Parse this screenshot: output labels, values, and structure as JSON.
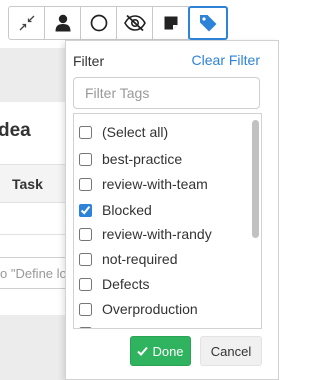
{
  "background": {
    "heading_fragment": "dea",
    "column_header": "Task",
    "input_placeholder_fragment": "o \"Define lo"
  },
  "toolbar": {
    "buttons": [
      {
        "icon": "collapse-arrows-icon",
        "active": false
      },
      {
        "icon": "user-icon",
        "active": false
      },
      {
        "icon": "circle-icon",
        "active": false
      },
      {
        "icon": "eye-slash-icon",
        "active": false
      },
      {
        "icon": "sticky-note-icon",
        "active": false
      },
      {
        "icon": "tag-icon",
        "active": true
      }
    ],
    "accent_color": "#2d83d8"
  },
  "filter_popup": {
    "title": "Filter",
    "clear_label": "Clear Filter",
    "search_placeholder": "Filter Tags",
    "search_value": "",
    "tags": [
      {
        "label": "(Select all)",
        "checked": false
      },
      {
        "label": "best-practice",
        "checked": false
      },
      {
        "label": "review-with-team",
        "checked": false
      },
      {
        "label": "Blocked",
        "checked": true
      },
      {
        "label": "review-with-randy",
        "checked": false
      },
      {
        "label": "not-required",
        "checked": false
      },
      {
        "label": "Defects",
        "checked": false
      },
      {
        "label": "Overproduction",
        "checked": false
      }
    ],
    "done_label": "Done",
    "cancel_label": "Cancel",
    "done_color": "#2fb35e"
  }
}
